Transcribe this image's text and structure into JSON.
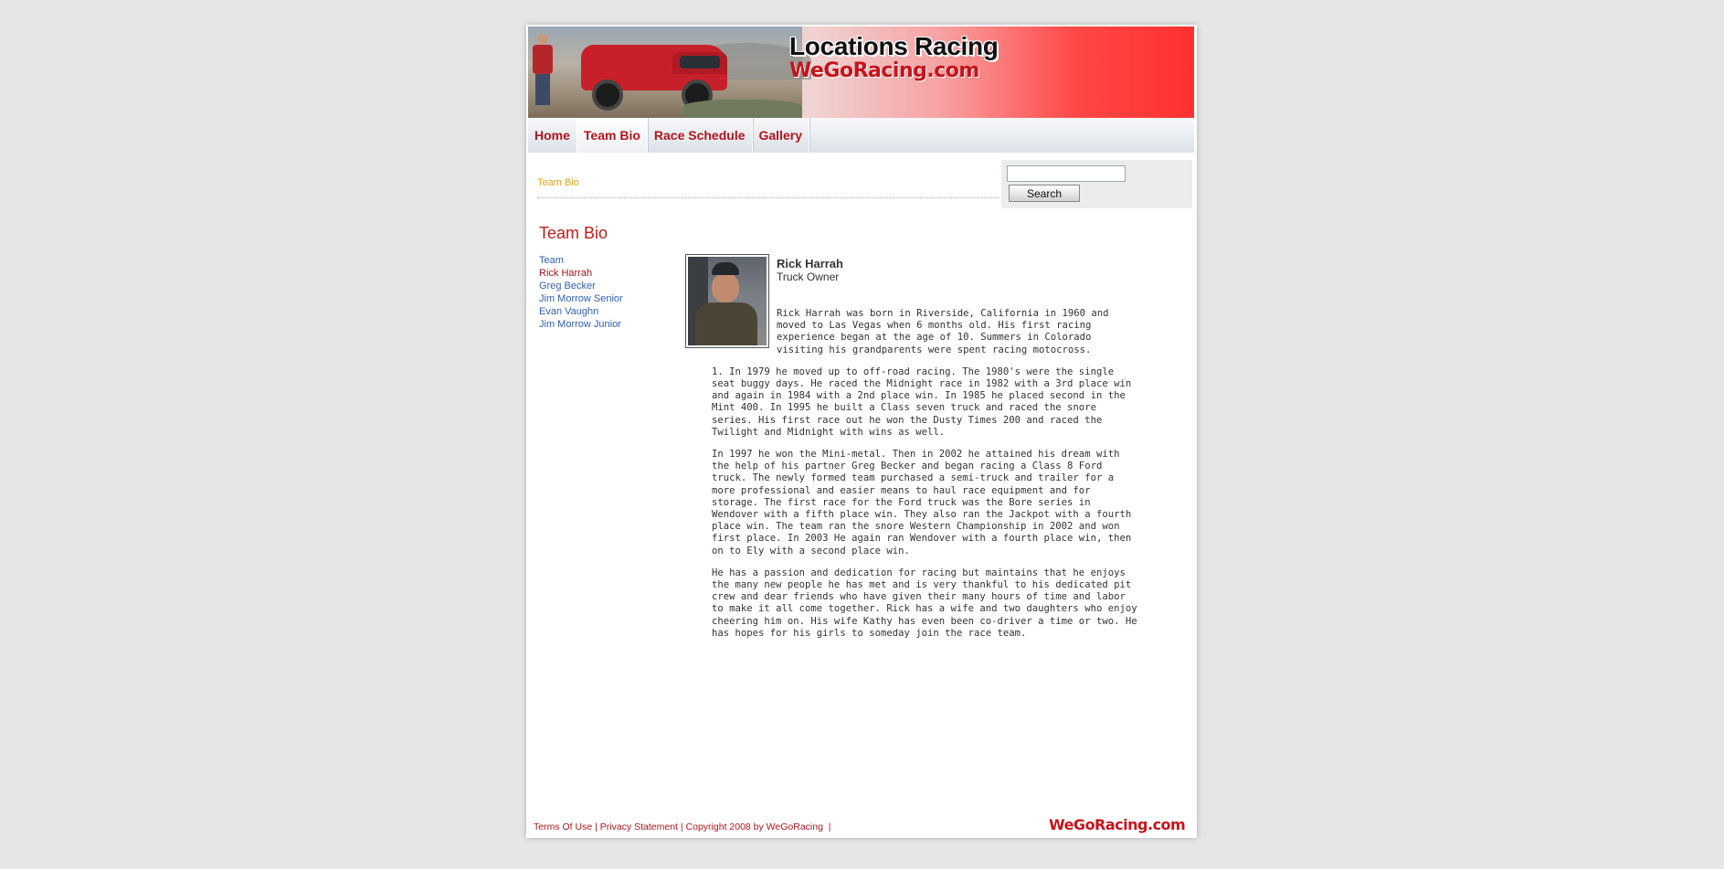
{
  "header": {
    "title_main": "Locations Racing",
    "title_sub": "WeGoRacing.com"
  },
  "nav": {
    "items": [
      {
        "label": "Home"
      },
      {
        "label": "Team Bio"
      },
      {
        "label": "Race Schedule"
      },
      {
        "label": "Gallery"
      }
    ],
    "active": "Team Bio"
  },
  "breadcrumb": "Team Bio",
  "search": {
    "value": "",
    "button_label": "Search"
  },
  "page_title": "Team Bio",
  "subnav": {
    "items": [
      "Team",
      "Rick Harrah",
      "Greg Becker",
      "Jim Morrow Senior",
      "Evan Vaughn",
      "Jim Morrow Junior"
    ],
    "current": "Rick Harrah"
  },
  "profile": {
    "name": "Rick Harrah",
    "role": "Truck Owner",
    "paragraphs": [
      "Rick Harrah was born in Riverside, California in 1960 and moved to Las Vegas when 6 months old. His first racing experience began at the age of 10. Summers in Colorado visiting his grandparents were spent racing motocross.",
      "1. In 1979 he moved up to off-road racing. The 1980's were the single seat buggy days. He raced the Midnight race in 1982 with a 3rd place win and again in 1984 with a 2nd place win. In 1985 he placed second in the Mint 400. In 1995 he built a Class seven truck and raced the snore series. His first race out he won the Dusty Times 200 and raced the Twilight and Midnight with wins as well.",
      "In 1997 he won the Mini-metal. Then in 2002 he attained his dream with the help of his partner Greg Becker and began racing a Class 8 Ford truck. The newly formed team purchased a semi-truck and trailer for a more professional and easier means to haul race equipment and for storage. The first race for the Ford truck was the Bore series in Wendover with a fifth place win. They also ran the Jackpot with a fourth place win. The team ran the snore Western Championship in 2002 and won first place. In 2003 He again ran Wendover with a fourth place win, then on to Ely with a second place win.",
      "He has a passion and dedication for racing but maintains that he enjoys the many new people he has met and is very thankful to his dedicated pit crew and dear friends who have given their many hours of time and labor to make it all come together. Rick has a wife and two daughters who enjoy cheering him on. His wife Kathy has even been co-driver a time or two. He has hopes for his girls to someday join the race team."
    ]
  },
  "footer": {
    "terms": "Terms Of Use",
    "privacy": "Privacy Statement",
    "copyright": "Copyright 2008 by WeGoRacing",
    "separator": "|",
    "logo": "WeGoRacing.com"
  }
}
